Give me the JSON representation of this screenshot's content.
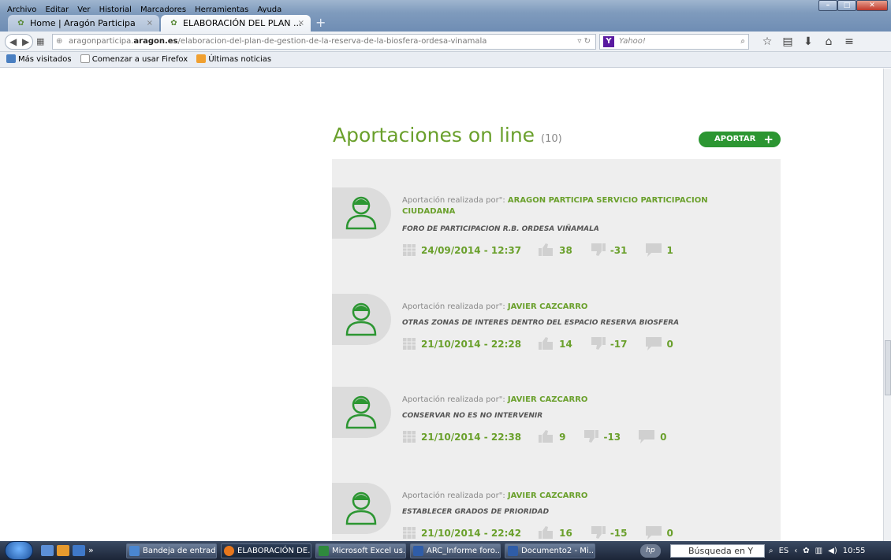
{
  "menubar": {
    "items": [
      "Archivo",
      "Editar",
      "Ver",
      "Historial",
      "Marcadores",
      "Herramientas",
      "Ayuda"
    ]
  },
  "tabs": [
    {
      "label": "Home | Aragón Participa",
      "close": "×"
    },
    {
      "label": "ELABORACIÓN DEL PLAN ...",
      "close": "×"
    }
  ],
  "newtab": "+",
  "navbar": {
    "url_prefix": "aragonparticipa.",
    "url_domain": "aragon.es",
    "url_path": "/elaboracion-del-plan-de-gestion-de-la-reserva-de-la-biosfera-ordesa-vinamala",
    "search_placeholder": "Yahoo!",
    "yahoo_logo": "Y"
  },
  "bookmarks": [
    "Más visitados",
    "Comenzar a usar Firefox",
    "Últimas noticias"
  ],
  "page": {
    "heading": "Aportaciones on line",
    "count": "(10)",
    "aportar_label": "APORTAR",
    "aportar_plus": "+",
    "entries": [
      {
        "prefix": "Aportación realizada por\": ",
        "author": "ARAGON PARTICIPA SERVICIO PARTICIPACION CIUDADANA",
        "title": "FORO DE PARTICIPACION R.B. ORDESA VIÑAMALA",
        "date": "24/09/2014 - 12:37",
        "likes": "38",
        "dislikes": "-31",
        "comments": "1"
      },
      {
        "prefix": "Aportación realizada por\": ",
        "author": "JAVIER CAZCARRO",
        "title": "OTRAS ZONAS DE INTERES DENTRO DEL ESPACIO RESERVA BIOSFERA",
        "date": "21/10/2014 - 22:28",
        "likes": "14",
        "dislikes": "-17",
        "comments": "0"
      },
      {
        "prefix": "Aportación realizada por\": ",
        "author": "JAVIER CAZCARRO",
        "title": "CONSERVAR NO ES NO INTERVENIR",
        "date": "21/10/2014 - 22:38",
        "likes": "9",
        "dislikes": "-13",
        "comments": "0"
      },
      {
        "prefix": "Aportación realizada por\": ",
        "author": "JAVIER CAZCARRO",
        "title": "ESTABLECER GRADOS DE PRIORIDAD",
        "date": "21/10/2014 - 22:42",
        "likes": "16",
        "dislikes": "-15",
        "comments": "0"
      }
    ]
  },
  "taskbar": {
    "buttons": [
      "Bandeja de entrad...",
      "ELABORACIÓN DE...",
      "Microsoft Excel us...",
      "ARC_Informe foro...",
      "Documento2 - Mi..."
    ],
    "overflow": "»",
    "search_text": "Búsqueda en Y",
    "lang": "ES",
    "clock": "10:55"
  },
  "colors": {
    "accent_green": "#6aa02c",
    "button_green": "#2c9632",
    "list_bg": "#eeeeee"
  }
}
